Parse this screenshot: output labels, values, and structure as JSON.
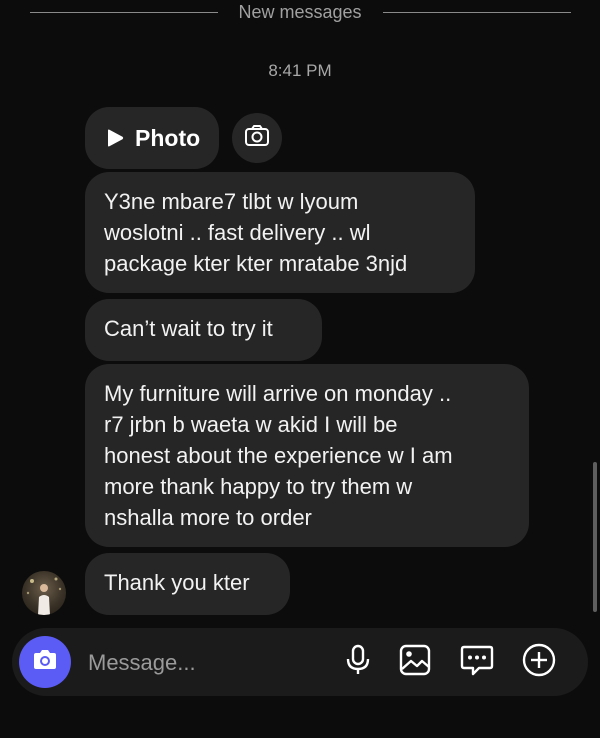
{
  "divider": {
    "label": "New messages"
  },
  "timestamp": "8:41 PM",
  "photo_attachment": {
    "label": "Photo",
    "icon": "play-icon"
  },
  "messages": [
    {
      "lines": [
        "Y3ne mbare7 tlbt w lyoum",
        "woslotni .. fast delivery .. wl",
        "package kter kter mratabe 3njd"
      ]
    },
    {
      "lines": [
        "Can’t wait to try it"
      ]
    },
    {
      "lines": [
        "My furniture will arrive on monday ..",
        "r7 jrbn b waeta w akid I will be",
        "honest about the experience w I am",
        "more thank happy to try them w",
        "nshalla more to order"
      ]
    },
    {
      "lines": [
        "Thank you kter"
      ]
    }
  ],
  "composer": {
    "placeholder": "Message...",
    "icons": [
      "camera-icon",
      "microphone-icon",
      "gallery-icon",
      "sticker-icon",
      "add-icon"
    ],
    "accent": "#5b5bf5"
  }
}
